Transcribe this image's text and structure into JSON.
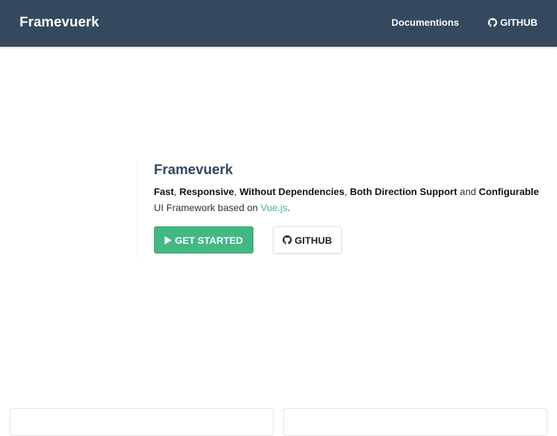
{
  "navbar": {
    "brand": "Framevuerk",
    "links": [
      {
        "label": "Documentions",
        "icon": ""
      },
      {
        "label": "GITHUB",
        "icon": "github-icon"
      }
    ],
    "background": "#34495e"
  },
  "hero": {
    "title": "Framevuerk",
    "features": [
      "Fast",
      "Responsive",
      "Without Dependencies",
      "Both Direction Support",
      "Configurable"
    ],
    "sep_comma": ",",
    "sep_and": "and",
    "tagline_prefix": "UI Framework based on",
    "tagline_link": "Vue.js",
    "tagline_suffix": ".",
    "primary_button": {
      "label": "GET STARTED",
      "icon": "play-icon"
    },
    "secondary_button": {
      "label": "GITHUB",
      "icon": "github-icon"
    }
  },
  "colors": {
    "accent": "#42b983",
    "navbar": "#34495e",
    "title": "#34495e"
  }
}
